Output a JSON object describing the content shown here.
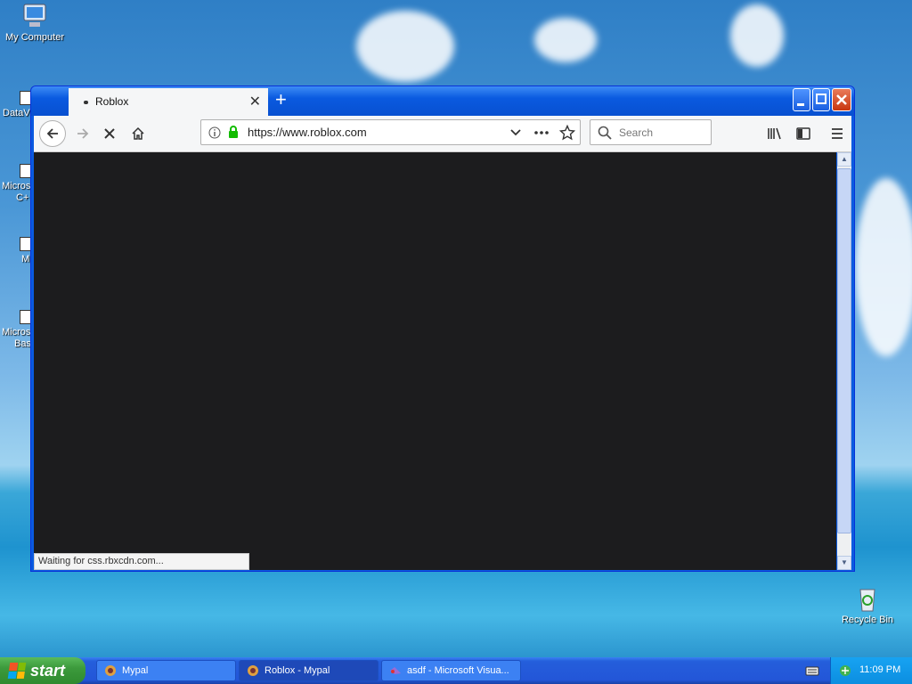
{
  "desktop": {
    "icons": [
      {
        "label": "My Computer"
      },
      {
        "label": "Recycle Bin"
      }
    ],
    "partial_labels": [
      "DataV",
      "Microso",
      "C+",
      "M",
      "Microso",
      "Bas"
    ]
  },
  "browser": {
    "tab": {
      "title": "Roblox"
    },
    "url": "https://www.roblox.com",
    "search_placeholder": "Search",
    "status_text": "Waiting for css.rbxcdn.com..."
  },
  "taskbar": {
    "start_label": "start",
    "buttons": [
      {
        "label": "Mypal"
      },
      {
        "label": "Roblox - Mypal"
      },
      {
        "label": "asdf - Microsoft Visua..."
      }
    ],
    "clock": "11:09 PM"
  }
}
